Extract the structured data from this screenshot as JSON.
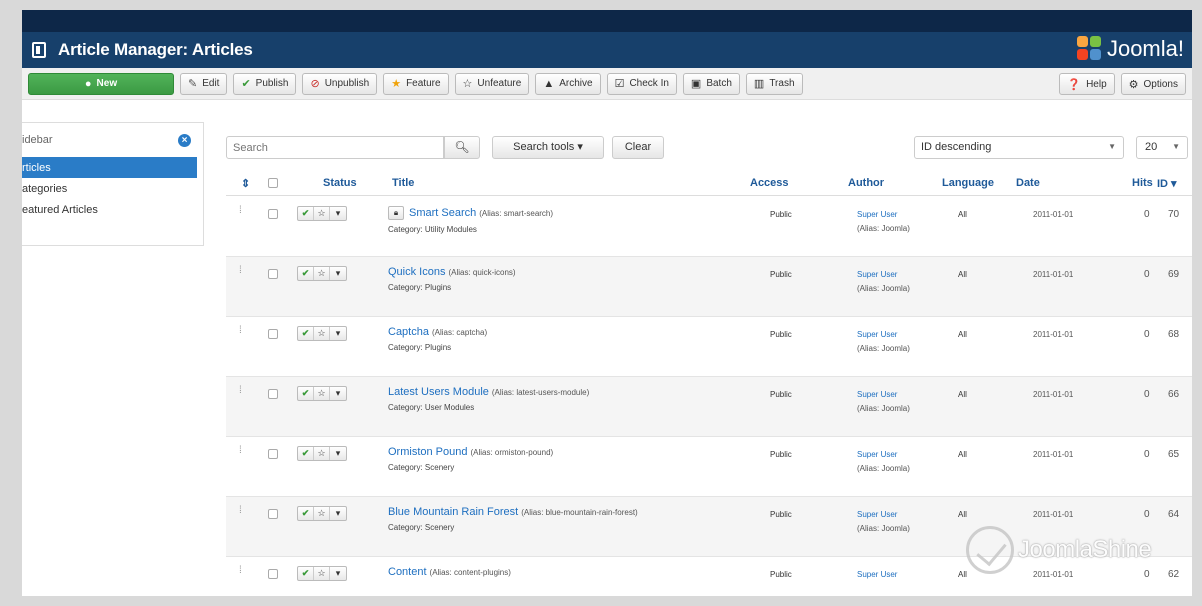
{
  "header": {
    "title": "Article Manager: Articles",
    "logo_text": "Joomla!"
  },
  "colors": {
    "header_bg": "#17406b",
    "new_button": "#46a84e",
    "link": "#1e6fc0",
    "active_sidebar": "#2a7cc7"
  },
  "toolbar": {
    "new": "New",
    "edit": "Edit",
    "publish": "Publish",
    "unpublish": "Unpublish",
    "feature": "Feature",
    "unfeature": "Unfeature",
    "archive": "Archive",
    "checkin": "Check In",
    "batch": "Batch",
    "trash": "Trash",
    "help": "Help",
    "options": "Options"
  },
  "sidebar": {
    "label": "idebar",
    "items": [
      {
        "label": "rticles",
        "active": true
      },
      {
        "label": "ategories",
        "active": false
      },
      {
        "label": "eatured Articles",
        "active": false
      }
    ]
  },
  "filters": {
    "search_placeholder": "Search",
    "search_tools": "Search tools ▾",
    "clear": "Clear",
    "sort_value": "ID descending",
    "limit_value": "20"
  },
  "table": {
    "columns": {
      "sort_glyph": "⇕",
      "status": "Status",
      "title": "Title",
      "access": "Access",
      "author": "Author",
      "language": "Language",
      "date": "Date",
      "hits": "Hits",
      "id": "ID ▾"
    },
    "rows": [
      {
        "title": "Smart Search",
        "alias": "(Alias: smart-search)",
        "category": "Category: Utility Modules",
        "access": "Public",
        "author": "Super User",
        "author_alias": "(Alias: Joomla)",
        "language": "All",
        "date": "2011-01-01",
        "hits": "0",
        "id": "70",
        "locked": true
      },
      {
        "title": "Quick Icons",
        "alias": "(Alias: quick-icons)",
        "category": "Category: Plugins",
        "access": "Public",
        "author": "Super User",
        "author_alias": "(Alias: Joomla)",
        "language": "All",
        "date": "2011-01-01",
        "hits": "0",
        "id": "69",
        "locked": false
      },
      {
        "title": "Captcha",
        "alias": "(Alias: captcha)",
        "category": "Category: Plugins",
        "access": "Public",
        "author": "Super User",
        "author_alias": "(Alias: Joomla)",
        "language": "All",
        "date": "2011-01-01",
        "hits": "0",
        "id": "68",
        "locked": false
      },
      {
        "title": "Latest Users Module",
        "alias": "(Alias: latest-users-module)",
        "category": "Category: User Modules",
        "access": "Public",
        "author": "Super User",
        "author_alias": "(Alias: Joomla)",
        "language": "All",
        "date": "2011-01-01",
        "hits": "0",
        "id": "66",
        "locked": false
      },
      {
        "title": "Ormiston Pound",
        "alias": "(Alias: ormiston-pound)",
        "category": "Category: Scenery",
        "access": "Public",
        "author": "Super User",
        "author_alias": "(Alias: Joomla)",
        "language": "All",
        "date": "2011-01-01",
        "hits": "0",
        "id": "65",
        "locked": false
      },
      {
        "title": "Blue Mountain Rain Forest",
        "alias": "(Alias: blue-mountain-rain-forest)",
        "category": "Category: Scenery",
        "access": "Public",
        "author": "Super User",
        "author_alias": "(Alias: Joomla)",
        "language": "All",
        "date": "2011-01-01",
        "hits": "0",
        "id": "64",
        "locked": false
      },
      {
        "title": "Content",
        "alias": "(Alias: content-plugins)",
        "category": "",
        "access": "Public",
        "author": "Super User",
        "author_alias": "",
        "language": "All",
        "date": "2011-01-01",
        "hits": "0",
        "id": "62",
        "locked": false
      }
    ]
  },
  "watermark": {
    "text": "JoomlaShine"
  }
}
